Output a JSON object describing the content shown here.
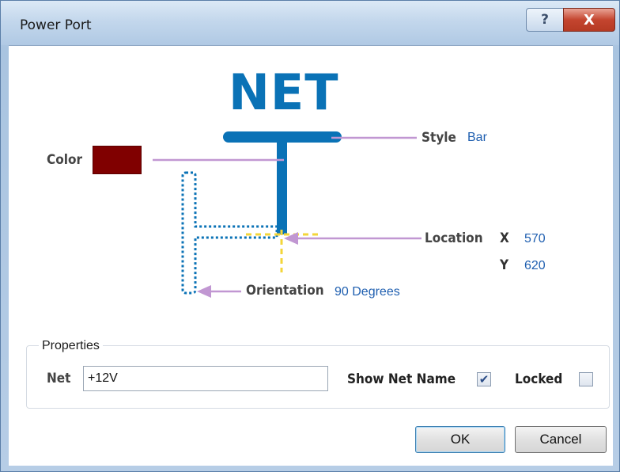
{
  "window": {
    "title": "Power Port",
    "help_glyph": "?",
    "close_glyph": "X"
  },
  "diagram": {
    "net_text": "NET",
    "color_label": "Color",
    "color_value": "#800000",
    "style_label": "Style",
    "style_value": "Bar",
    "location_label": "Location",
    "x_label": "X",
    "x_value": "570",
    "y_label": "Y",
    "y_value": "620",
    "orientation_label": "Orientation",
    "orientation_value": "90 Degrees",
    "colors": {
      "symbol": "#0a72b6",
      "arrow": "#c197d2",
      "hotspot": "#f3d53a",
      "value_text": "#1f5fb0"
    }
  },
  "properties": {
    "group_title": "Properties",
    "net_label": "Net",
    "net_value": "+12V",
    "show_net_name_label": "Show Net Name",
    "show_net_name_checked": true,
    "locked_label": "Locked",
    "locked_checked": false
  },
  "buttons": {
    "ok": "OK",
    "cancel": "Cancel"
  }
}
